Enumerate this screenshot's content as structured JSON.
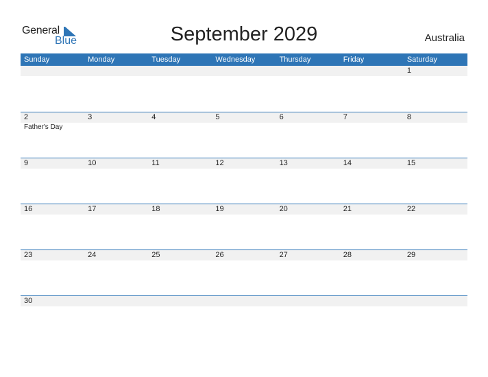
{
  "logo": {
    "general": "General",
    "blue": "Blue"
  },
  "title": "September 2029",
  "country": "Australia",
  "weekdays": [
    "Sunday",
    "Monday",
    "Tuesday",
    "Wednesday",
    "Thursday",
    "Friday",
    "Saturday"
  ],
  "weeks": [
    {
      "days": [
        "",
        "",
        "",
        "",
        "",
        "",
        "1"
      ],
      "events": [
        "",
        "",
        "",
        "",
        "",
        "",
        ""
      ]
    },
    {
      "days": [
        "2",
        "3",
        "4",
        "5",
        "6",
        "7",
        "8"
      ],
      "events": [
        "Father's Day",
        "",
        "",
        "",
        "",
        "",
        ""
      ]
    },
    {
      "days": [
        "9",
        "10",
        "11",
        "12",
        "13",
        "14",
        "15"
      ],
      "events": [
        "",
        "",
        "",
        "",
        "",
        "",
        ""
      ]
    },
    {
      "days": [
        "16",
        "17",
        "18",
        "19",
        "20",
        "21",
        "22"
      ],
      "events": [
        "",
        "",
        "",
        "",
        "",
        "",
        ""
      ]
    },
    {
      "days": [
        "23",
        "24",
        "25",
        "26",
        "27",
        "28",
        "29"
      ],
      "events": [
        "",
        "",
        "",
        "",
        "",
        "",
        ""
      ]
    },
    {
      "days": [
        "30",
        "",
        "",
        "",
        "",
        "",
        ""
      ],
      "events": [
        "",
        "",
        "",
        "",
        "",
        "",
        ""
      ]
    }
  ],
  "colors": {
    "accent": "#2e75b6",
    "date_strip": "#f1f1f1"
  }
}
